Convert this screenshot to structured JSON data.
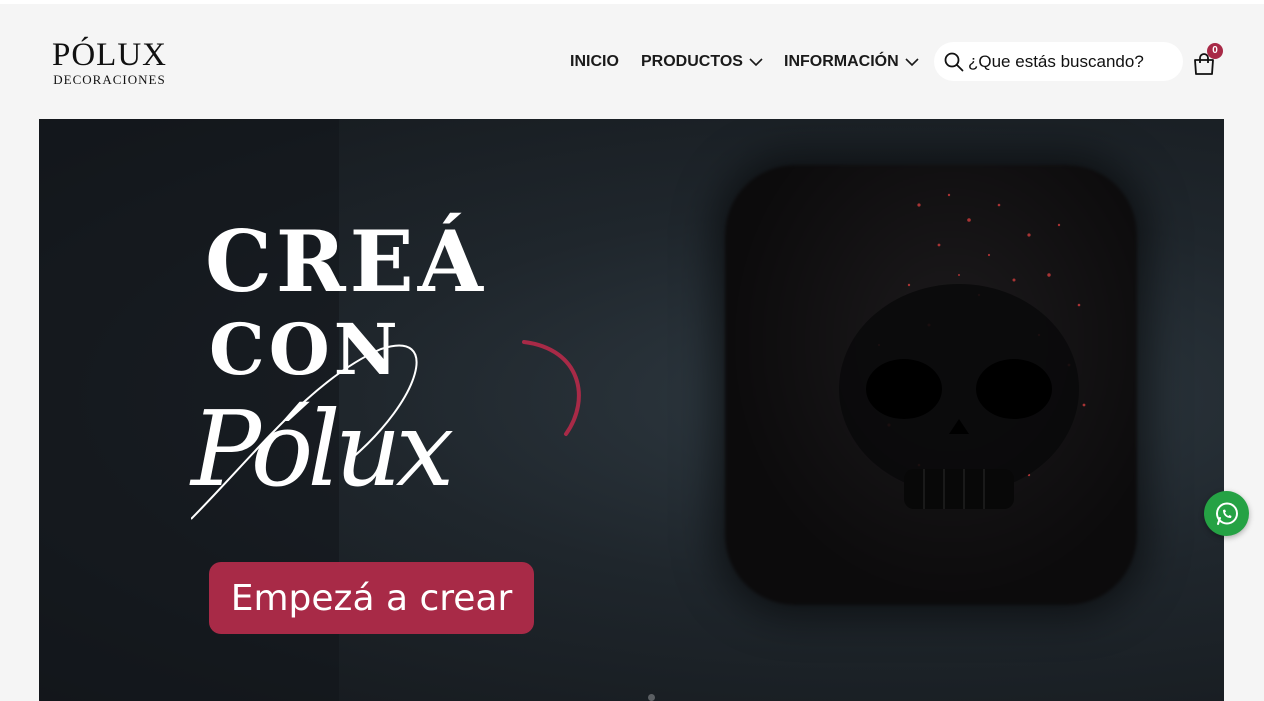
{
  "brand": {
    "title": "PÓLUX",
    "subtitle": "Decoraciones"
  },
  "nav": {
    "items": [
      {
        "label": "INICIO",
        "has_dropdown": false
      },
      {
        "label": "PRODUCTOS",
        "has_dropdown": true
      },
      {
        "label": "INFORMACIÓN",
        "has_dropdown": true
      }
    ]
  },
  "search": {
    "placeholder": "¿Que estás buscando?",
    "icon": "search-icon"
  },
  "cart": {
    "count": "0",
    "icon": "shopping-bag-icon"
  },
  "hero": {
    "title_line1": "CREÁ",
    "title_line2": "CON",
    "script_word": "Pólux",
    "cta_label": "Empezá a crear",
    "slide_dots": 1
  },
  "whatsapp": {
    "icon": "whatsapp-icon"
  },
  "colors": {
    "accent": "#a82a47",
    "whatsapp": "#25a244",
    "page_bg": "#f5f5f5"
  }
}
